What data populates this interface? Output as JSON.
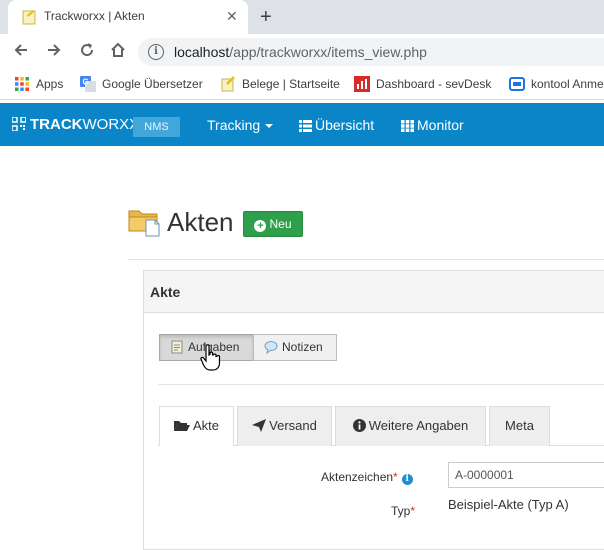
{
  "browser": {
    "tab_title": "Trackworxx | Akten",
    "close_glyph": "✕",
    "newtab_glyph": "+",
    "url_host": "localhost",
    "url_path": "/app/trackworxx/items_view.php",
    "bookmarks": [
      {
        "label": "Apps",
        "icon": "apps-grid-icon"
      },
      {
        "label": "Google Übersetzer",
        "icon": "google-translate-icon"
      },
      {
        "label": "Belege | Startseite",
        "icon": "belege-icon"
      },
      {
        "label": "Dashboard - sevDesk",
        "icon": "sevdesk-icon"
      },
      {
        "label": "kontool Anme",
        "icon": "kontool-icon"
      }
    ]
  },
  "navbar": {
    "brand_bold": "TRACK",
    "brand_light": "WORXX",
    "badge": "NMS",
    "links": [
      "Tracking",
      "Übersicht",
      "Monitor"
    ],
    "bg_color": "#0a86c8"
  },
  "page": {
    "title": "Akten",
    "new_button": "Neu",
    "panel_title": "Akte",
    "buttons": [
      "Aufgaben",
      "Notizen"
    ],
    "tabs": [
      "Akte",
      "Versand",
      "Weitere Angaben",
      "Meta"
    ]
  },
  "form": {
    "aktenzeichen_label": "Aktenzeichen",
    "aktenzeichen_value": "A-0000001",
    "typ_label": "Typ",
    "typ_value": "Beispiel-Akte (Typ A)",
    "required_mark": "*"
  }
}
